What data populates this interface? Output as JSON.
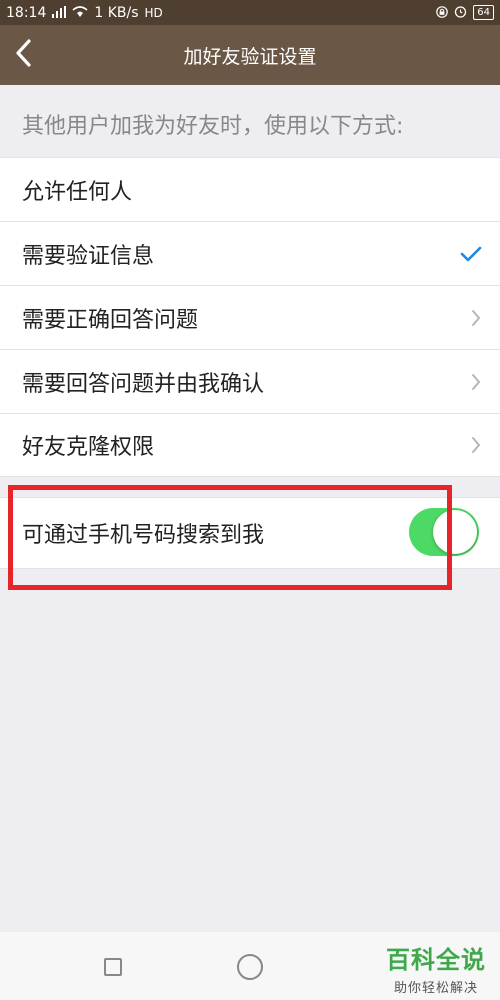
{
  "status_bar": {
    "time": "18:14",
    "signal": "4G",
    "speed": "1 KB/s",
    "network_badge": "HD",
    "battery": "64"
  },
  "header": {
    "title": "加好友验证设置",
    "back_icon": "chevron-left-icon"
  },
  "section_caption": "其他用户加我为好友时，使用以下方式:",
  "options": [
    {
      "label": "允许任何人",
      "indicator": "none"
    },
    {
      "label": "需要验证信息",
      "indicator": "check"
    },
    {
      "label": "需要正确回答问题",
      "indicator": "chevron"
    },
    {
      "label": "需要回答问题并由我确认",
      "indicator": "chevron"
    },
    {
      "label": "好友克隆权限",
      "indicator": "chevron"
    }
  ],
  "phone_search": {
    "label": "可通过手机号码搜索到我",
    "enabled": true
  },
  "watermark": {
    "main": "百科全说",
    "sub": "助你轻松解决"
  },
  "colors": {
    "header_bg": "#6b5746",
    "status_bg": "#4f3f30",
    "check": "#1e8ae5",
    "toggle_on": "#4cd964",
    "highlight": "#e8242b"
  }
}
